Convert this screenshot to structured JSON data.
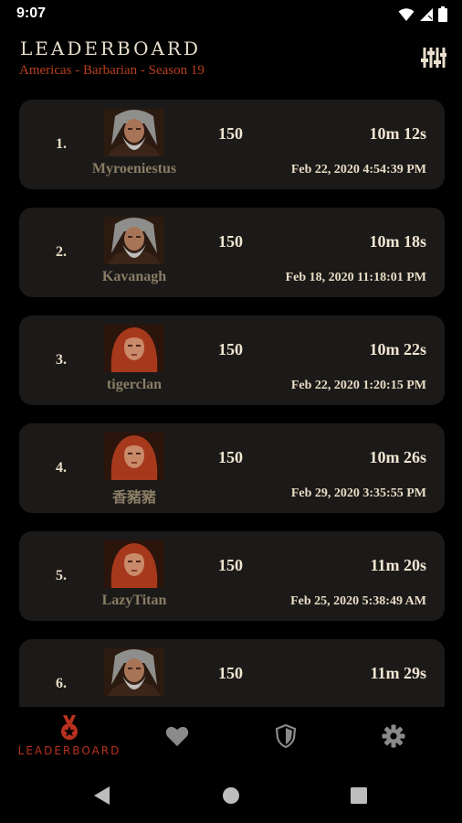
{
  "status_bar": {
    "time": "9:07",
    "icons": [
      "wifi-icon",
      "cell-signal-icon",
      "battery-icon"
    ]
  },
  "header": {
    "title": "LEADERBOARD",
    "subtitle": "Americas - Barbarian - Season 19",
    "filter_icon": "sliders-icon"
  },
  "colors": {
    "background": "#000000",
    "card": "#1c1a18",
    "accent": "#b8401c",
    "name_text": "#8a7d66",
    "primary_text": "#f0e6d3"
  },
  "entries": [
    {
      "rank": "1.",
      "name": "Myroeniestus",
      "level": "150",
      "time": "10m 12s",
      "date": "Feb 22, 2020 4:54:39 PM",
      "avatar": "male-barbarian-avatar"
    },
    {
      "rank": "2.",
      "name": "Kavanagh",
      "level": "150",
      "time": "10m 18s",
      "date": "Feb 18, 2020 11:18:01 PM",
      "avatar": "male-barbarian-avatar"
    },
    {
      "rank": "3.",
      "name": "tigerclan",
      "level": "150",
      "time": "10m 22s",
      "date": "Feb 22, 2020 1:20:15 PM",
      "avatar": "female-barbarian-avatar"
    },
    {
      "rank": "4.",
      "name": "香豬豬",
      "level": "150",
      "time": "10m 26s",
      "date": "Feb 29, 2020 3:35:55 PM",
      "avatar": "female-barbarian-avatar"
    },
    {
      "rank": "5.",
      "name": "LazyTitan",
      "level": "150",
      "time": "11m 20s",
      "date": "Feb 25, 2020 5:38:49 AM",
      "avatar": "female-barbarian-avatar"
    },
    {
      "rank": "6.",
      "name": "",
      "level": "150",
      "time": "11m 29s",
      "date": "",
      "avatar": "male-barbarian-avatar"
    }
  ],
  "bottom_nav": [
    {
      "label": "LEADERBOARD",
      "icon": "leaderboard-medal-icon",
      "active": true
    },
    {
      "label": "",
      "icon": "heart-icon",
      "active": false
    },
    {
      "label": "",
      "icon": "shield-icon",
      "active": false
    },
    {
      "label": "",
      "icon": "gear-icon",
      "active": false
    }
  ],
  "system_nav": [
    "back-icon",
    "home-icon",
    "recents-icon"
  ]
}
